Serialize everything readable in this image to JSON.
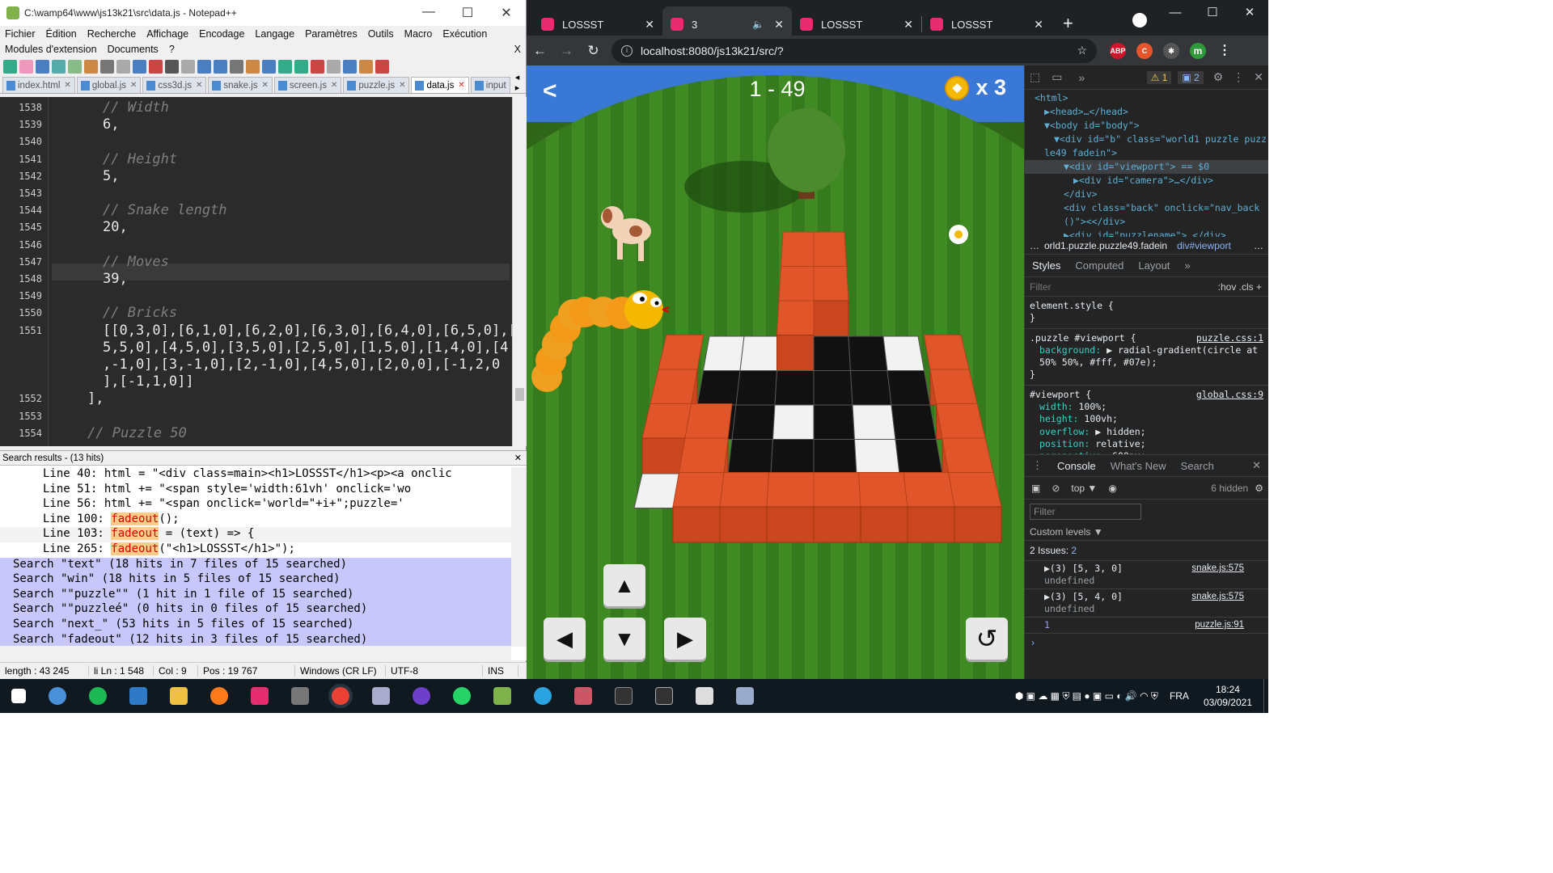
{
  "npp": {
    "title": "C:\\wamp64\\www\\js13k21\\src\\data.js - Notepad++",
    "win_min": "—",
    "win_max": "☐",
    "win_close": "✕",
    "menu1": [
      "Fichier",
      "Édition",
      "Recherche",
      "Affichage",
      "Encodage",
      "Langage",
      "Paramètres",
      "Outils",
      "Macro",
      "Exécution"
    ],
    "menu2": [
      "Modules d'extension",
      "Documents",
      "?"
    ],
    "menu2_close": "X",
    "tabs": [
      "index.html",
      "global.js",
      "css3d.js",
      "snake.js",
      "screen.js",
      "puzzle.js",
      "data.js",
      "input"
    ],
    "code": [
      {
        "ln": "1538",
        "text": "// Width",
        "kind": "cmt"
      },
      {
        "ln": "1539",
        "text": "6,",
        "kind": "num"
      },
      {
        "ln": "1540",
        "text": "",
        "kind": "num"
      },
      {
        "ln": "1541",
        "text": "// Height",
        "kind": "cmt"
      },
      {
        "ln": "1542",
        "text": "5,",
        "kind": "num"
      },
      {
        "ln": "1543",
        "text": "",
        "kind": "num"
      },
      {
        "ln": "1544",
        "text": "// Snake length",
        "kind": "cmt"
      },
      {
        "ln": "1545",
        "text": "20,",
        "kind": "num"
      },
      {
        "ln": "1546",
        "text": "",
        "kind": "num"
      },
      {
        "ln": "1547",
        "text": "// Moves",
        "kind": "cmt"
      },
      {
        "ln": "1548",
        "text": "39,",
        "kind": "num"
      },
      {
        "ln": "1549",
        "text": "",
        "kind": "num"
      },
      {
        "ln": "1550",
        "text": "// Bricks",
        "kind": "cmt"
      },
      {
        "ln": "1551",
        "text": "[[0,3,0],[6,1,0],[6,2,0],[6,3,0],[6,4,0],[6,5,0],[",
        "kind": "num"
      },
      {
        "ln": "",
        "text": "5,5,0],[4,5,0],[3,5,0],[2,5,0],[1,5,0],[1,4,0],[4",
        "kind": "num"
      },
      {
        "ln": "",
        "text": ",-1,0],[3,-1,0],[2,-1,0],[4,5,0],[2,0,0],[-1,2,0",
        "kind": "num"
      },
      {
        "ln": "",
        "text": "],[-1,1,0]]",
        "kind": "num"
      },
      {
        "ln": "1552",
        "text": "],",
        "kind": "num"
      },
      {
        "ln": "1553",
        "text": "",
        "kind": "num"
      },
      {
        "ln": "1554",
        "text": "// Puzzle 50",
        "kind": "cmt"
      }
    ],
    "search_title": "Search results - (13 hits)",
    "search_close": "✕",
    "search_hits": [
      {
        "pre": "Line 40:     html = \"<div class=main><h1>LOSSST</h1><p><a onclic",
        "hl": "",
        "post": ""
      },
      {
        "pre": "Line 51:           html += \"<span style='width:61vh' onclick='wo",
        "hl": "",
        "post": ""
      },
      {
        "pre": "Line 56:             html += \"<span onclick='world=\"+i+\";puzzle='",
        "hl": "",
        "post": ""
      },
      {
        "pre": "Line 100:   ",
        "hl": "fadeout",
        "post": "();"
      },
      {
        "pre": "Line 103: ",
        "hl": "fadeout",
        "post": " = (text) => {"
      },
      {
        "pre": "Line 265:       ",
        "hl": "fadeout",
        "post": "(\"<h1>LOSSST</h1>\");"
      }
    ],
    "search_headers": [
      "Search \"text\" (18 hits in 7 files of 15 searched)",
      "Search \"win\" (18 hits in 5 files of 15 searched)",
      "Search \"\"puzzle\"\" (1 hit in 1 file of 15 searched)",
      "Search \"\"puzzleé\" (0 hits in 0 files of 15 searched)",
      "Search \"next_\" (53 hits in 5 files of 15 searched)",
      "Search \"fadeout\" (12 hits in 3 files of 15 searched)"
    ],
    "status": [
      "length : 43 245",
      "li Ln : 1 548",
      "Col : 9",
      "Pos : 19 767",
      "Windows (CR LF)",
      "UTF-8",
      "INS"
    ]
  },
  "chrome": {
    "tabs": [
      {
        "label": "LOSSST",
        "active": false
      },
      {
        "label": "3",
        "active": true
      },
      {
        "label": "LOSSST",
        "active": false
      },
      {
        "label": "LOSSST",
        "active": false
      }
    ],
    "tab_close": "✕",
    "new_tab": "+",
    "win_min": "—",
    "win_max": "☐",
    "win_close": "✕",
    "url": "localhost:8080/js13k21/src/?",
    "ext_abp": "ABP",
    "ext_c": "C",
    "profile_letter": "m"
  },
  "game": {
    "back": "<",
    "level": "1 - 49",
    "coins": "x 3",
    "grid": [
      [
        "x",
        "x",
        "x",
        "B",
        "B",
        "x",
        "x",
        "x"
      ],
      [
        "x",
        "x",
        "x",
        "B",
        "B",
        "x",
        "x",
        "x"
      ],
      [
        "x",
        "W",
        "W",
        "B",
        "K",
        "K",
        "W",
        "x"
      ],
      [
        "B",
        "K",
        "K",
        "K",
        "K",
        "K",
        "K",
        "B"
      ],
      [
        "B",
        "K",
        "K",
        "W",
        "K",
        "W",
        "K",
        "B"
      ],
      [
        "B",
        "B",
        "K",
        "K",
        "K",
        "W",
        "K",
        "B"
      ],
      [
        "W",
        "B",
        "K",
        "K",
        "K",
        "K",
        "K",
        "B"
      ],
      [
        "x",
        "B",
        "B",
        "B",
        "B",
        "B",
        "B",
        "B"
      ]
    ],
    "btn_up": "▲",
    "btn_left": "◀",
    "btn_down": "▼",
    "btn_right": "▶",
    "btn_restart": "↺"
  },
  "devtools": {
    "warn_count": "1",
    "info_count": "2",
    "dom": [
      {
        "indent": 0,
        "html": "<html>"
      },
      {
        "indent": 1,
        "html": "▶<head>…</head>"
      },
      {
        "indent": 1,
        "html": "▼<body id=\"body\">"
      },
      {
        "indent": 2,
        "html": "▼<div id=\"b\" class=\"world1 puzzle puzz"
      },
      {
        "indent": 1,
        "html": "le49 fadein\">"
      },
      {
        "indent": 3,
        "html": "▼<div id=\"viewport\"> == $0",
        "sel": true
      },
      {
        "indent": 4,
        "html": "▶<div id=\"camera\">…</div>"
      },
      {
        "indent": 3,
        "html": "</div>"
      },
      {
        "indent": 3,
        "html": "<div class=\"back\" onclick=\"nav_back"
      },
      {
        "indent": 3,
        "html": "()\"><</div>"
      },
      {
        "indent": 3,
        "html": "▶<div id=\"puzzlename\">…</div>"
      }
    ],
    "crumbs": [
      "…",
      "orld1.puzzle.puzzle49.fadein",
      "div#viewport",
      "…"
    ],
    "style_tabs": [
      "Styles",
      "Computed",
      "Layout",
      "»"
    ],
    "style_filter": "Filter",
    "style_filter_right": ":hov  .cls  +",
    "rules": [
      {
        "sel": "element.style {",
        "src": "",
        "props": [],
        "end": "}"
      },
      {
        "sel": ".puzzle #viewport {",
        "src": "puzzle.css:1",
        "props": [
          {
            "p": "background:",
            "v": "▶ radial-gradient(circle at"
          },
          {
            "p": "",
            "v": "50% 50%, #fff, #07e);"
          }
        ],
        "end": "}"
      },
      {
        "sel": "#viewport {",
        "src": "global.css:9",
        "props": [
          {
            "p": "width:",
            "v": "100%;"
          },
          {
            "p": "height:",
            "v": "100vh;"
          },
          {
            "p": "overflow:",
            "v": "▶ hidden;"
          },
          {
            "p": "position:",
            "v": "relative;"
          },
          {
            "p": "perspective:",
            "v": "600px;"
          }
        ],
        "end": ""
      }
    ],
    "console_tabs": [
      "Console",
      "What's New",
      "Search"
    ],
    "console_context": "top ▼",
    "hidden": "6 hidden",
    "console_filter": "Filter",
    "levels": "Custom levels ▼",
    "issues": "2 Issues:",
    "issues_count": "2",
    "logs": [
      {
        "text": "▶(3) [5, 3, 0]",
        "src": "snake.js:575",
        "sub": "undefined"
      },
      {
        "text": "▶(3) [5, 4, 0]",
        "src": "snake.js:575",
        "sub": "undefined"
      },
      {
        "text": "1",
        "src": "puzzle.js:91",
        "sub": ""
      }
    ]
  },
  "taskbar": {
    "lang": "FRA",
    "time": "18:24",
    "date": "03/09/2021"
  }
}
